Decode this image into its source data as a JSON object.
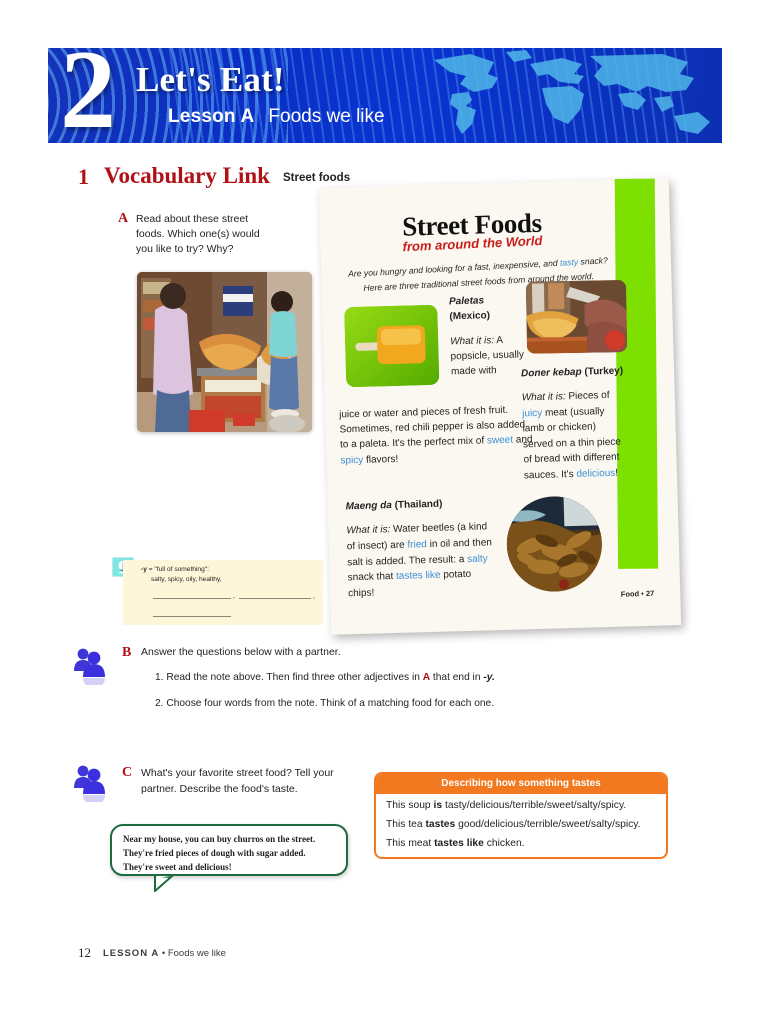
{
  "banner": {
    "unit_number": "2",
    "title": "Let's Eat!",
    "lesson": "Lesson A",
    "topic": "Foods we like"
  },
  "section": {
    "number": "1",
    "title": "Vocabulary Link",
    "topic": "Street foods"
  },
  "exercise_a": {
    "letter": "A",
    "instruction": "Read about these street foods. Which one(s) would you like to try? Why?",
    "photo_alt": "street-food-vendor-photo"
  },
  "magazine": {
    "title": "Street Foods",
    "subtitle": "from around the World",
    "lede_line1_before": "Are you hungry and looking for a fast, inexpensive, and ",
    "lede_highlight": "tasty",
    "lede_line1_after": " snack?",
    "lede_line2": "Here are three traditional street foods from around the world.",
    "folio": "Food • 27",
    "items": [
      {
        "name": "Paletas",
        "country": "(Mexico)",
        "label": "What it is:",
        "body_col": "A popsicle, usually made with",
        "body_rest_1": "juice or water and pieces of fresh fruit.  Sometimes, red chili pepper is also added to a paleta. It's the perfect mix of ",
        "hl_1": "sweet",
        "body_rest_2": " and ",
        "hl_2": "spicy",
        "body_rest_3": " flavors!",
        "image_alt": "paleta-popsicle-photo"
      },
      {
        "name": "Doner kebap",
        "country": "(Turkey)",
        "label": "What it is:",
        "body_1": " Pieces of ",
        "hl_1": "juicy",
        "body_2": " meat (usually lamb or chicken) served on a thin piece of bread with different sauces. It's ",
        "hl_2": "delicious",
        "body_3": "!",
        "image_alt": "doner-kebap-photo"
      },
      {
        "name": "Maeng da",
        "country": "(Thailand)",
        "label": "What it is:",
        "body_1": " Water beetles (a kind of insect) are ",
        "hl_1": "fried",
        "body_2": " in oil and then salt is added. The result: a ",
        "hl_2": "salty",
        "body_3": " snack that ",
        "hl_3": "tastes like",
        "body_4": " potato chips!",
        "image_alt": "fried-water-beetles-photo"
      }
    ]
  },
  "note": {
    "icon": "lightbulb-icon",
    "line1_suffix": " = \"full of something\":",
    "line1_prefix": "-y",
    "line2": "salty, spicy, oily, healthy,"
  },
  "exercise_b": {
    "letter": "B",
    "icon": "pair-work-icon",
    "instruction": "Answer the questions below with a partner.",
    "items": [
      {
        "number": "1.",
        "text_1": "Read the note above. Then find three other adjectives in ",
        "bold_ref": "A",
        "text_2": " that end in ",
        "italic_suffix": "-y.",
        "text_3": ""
      },
      {
        "number": "2.",
        "text_1": "Choose four words from the note. Think of a matching food for each one.",
        "bold_ref": "",
        "text_2": "",
        "italic_suffix": "",
        "text_3": ""
      }
    ]
  },
  "exercise_c": {
    "letter": "C",
    "icon": "pair-work-icon",
    "instruction": "What's your favorite street food? Tell your partner. Describe the food's taste."
  },
  "tastes_box": {
    "heading": "Describing how something tastes",
    "rows": [
      {
        "pre": "This soup ",
        "bold": "is",
        "post": " tasty/delicious/terrible/sweet/salty/spicy."
      },
      {
        "pre": "This tea ",
        "bold": "tastes",
        "post": " good/delicious/terrible/sweet/salty/spicy."
      },
      {
        "pre": "This meat ",
        "bold": "tastes like",
        "post": " chicken."
      }
    ]
  },
  "speech_bubble": {
    "text": "Near my house, you can buy churros on the street. They're fried pieces of dough with sugar added. They're sweet and delicious!"
  },
  "footer": {
    "page_number": "12",
    "lesson_label": "LESSON A",
    "separator": " • ",
    "topic": "Foods we like"
  },
  "colors": {
    "banner_blue": "#0b2fc4",
    "heading_red": "#b01116",
    "accent_green": "#7ee000",
    "highlight_blue": "#3d8fd6",
    "orange": "#f37920",
    "note_yellow": "#fdf6d8",
    "bubble_green": "#1f6b3f"
  }
}
